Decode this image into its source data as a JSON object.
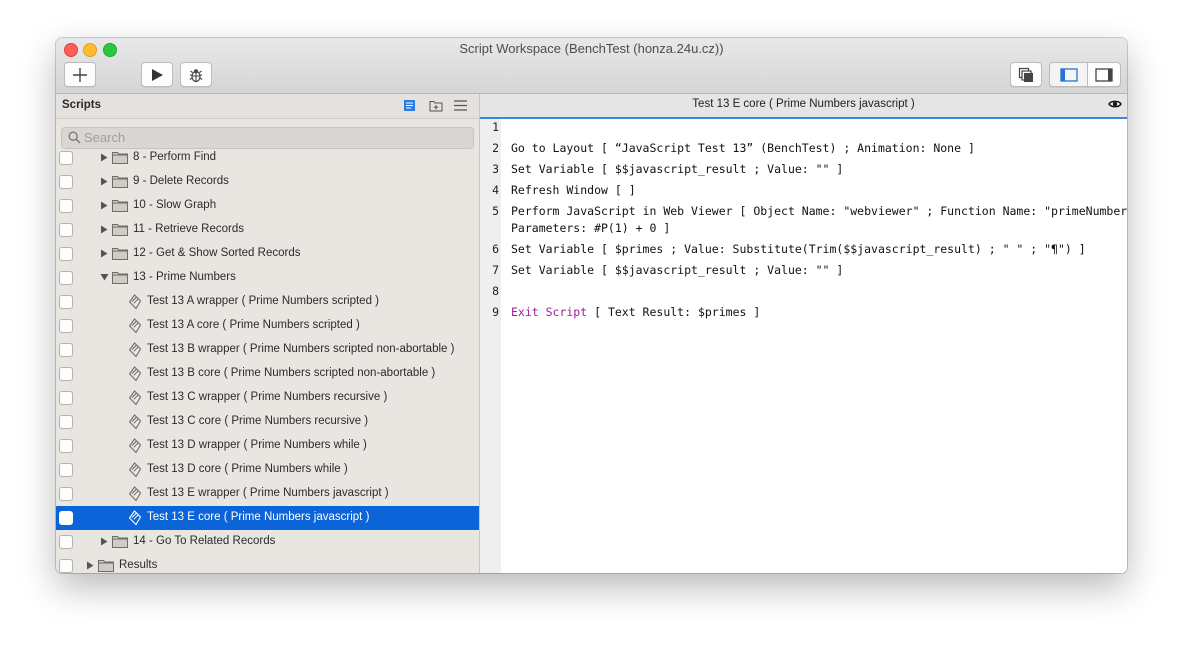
{
  "window": {
    "title": "Script Workspace (BenchTest (honza.24u.cz))"
  },
  "toolbar": {
    "new_icon": "plus-icon",
    "run_icon": "play-icon",
    "debug_icon": "bug-icon",
    "view_icons": [
      "stacked-windows-icon",
      "left-panel-icon",
      "right-panel-icon"
    ]
  },
  "sidebar": {
    "title": "Scripts",
    "search_placeholder": "Search",
    "items": [
      {
        "label": "8 - Perform Find",
        "type": "folder",
        "level": 1,
        "expanded": false
      },
      {
        "label": "9 - Delete Records",
        "type": "folder",
        "level": 1,
        "expanded": false
      },
      {
        "label": "10 - Slow Graph",
        "type": "folder",
        "level": 1,
        "expanded": false
      },
      {
        "label": "11 - Retrieve Records",
        "type": "folder",
        "level": 1,
        "expanded": false
      },
      {
        "label": "12 - Get & Show Sorted Records",
        "type": "folder",
        "level": 1,
        "expanded": false
      },
      {
        "label": "13 - Prime Numbers",
        "type": "folder",
        "level": 1,
        "expanded": true
      },
      {
        "label": "Test 13 A wrapper ( Prime Numbers scripted )",
        "type": "script",
        "level": 2
      },
      {
        "label": "Test 13 A core ( Prime Numbers scripted )",
        "type": "script",
        "level": 2
      },
      {
        "label": "Test 13 B wrapper ( Prime Numbers scripted non-abortable )",
        "type": "script",
        "level": 2
      },
      {
        "label": "Test 13 B core ( Prime Numbers scripted non-abortable )",
        "type": "script",
        "level": 2
      },
      {
        "label": "Test 13 C wrapper ( Prime Numbers recursive )",
        "type": "script",
        "level": 2
      },
      {
        "label": "Test 13 C core ( Prime Numbers recursive )",
        "type": "script",
        "level": 2
      },
      {
        "label": "Test 13 D wrapper ( Prime Numbers while )",
        "type": "script",
        "level": 2
      },
      {
        "label": "Test 13 D core ( Prime Numbers while )",
        "type": "script",
        "level": 2
      },
      {
        "label": "Test 13 E wrapper ( Prime Numbers javascript )",
        "type": "script",
        "level": 2
      },
      {
        "label": "Test 13 E core ( Prime Numbers javascript )",
        "type": "script",
        "level": 2,
        "selected": true
      },
      {
        "label": "14 - Go To Related Records",
        "type": "folder",
        "level": 1,
        "expanded": false
      },
      {
        "label": "Results",
        "type": "folder",
        "level": 0,
        "expanded": false
      }
    ]
  },
  "editor": {
    "title": "Test 13 E core ( Prime Numbers javascript )",
    "lines": [
      {
        "num": "1",
        "text": ""
      },
      {
        "num": "2",
        "text": "Go to Layout [ “JavaScript Test 13” (BenchTest) ; Animation: None ]"
      },
      {
        "num": "3",
        "text": "Set Variable [ $$javascript_result ; Value: \"\" ]"
      },
      {
        "num": "4",
        "text": "Refresh Window [ ]"
      },
      {
        "num": "5",
        "text": "Perform JavaScript in Web Viewer [ Object Name: \"webviewer\" ; Function Name: \"primeNumbers\" ;",
        "cont": "Parameters: #P(1) + 0 ]"
      },
      {
        "num": "6",
        "text": "Set Variable [ $primes ; Value: Substitute(Trim($$javascript_result) ; \" \" ; \"¶\") ]"
      },
      {
        "num": "7",
        "text": "Set Variable [ $$javascript_result ; Value: \"\" ]"
      },
      {
        "num": "8",
        "text": ""
      },
      {
        "num": "9",
        "text": " [ Text Result: $primes ]",
        "keyword": "Exit Script"
      }
    ]
  },
  "colors": {
    "selection": "#0b64d8",
    "control_keyword": "#a4189b",
    "active_tab_underline": "#3a85e0"
  }
}
